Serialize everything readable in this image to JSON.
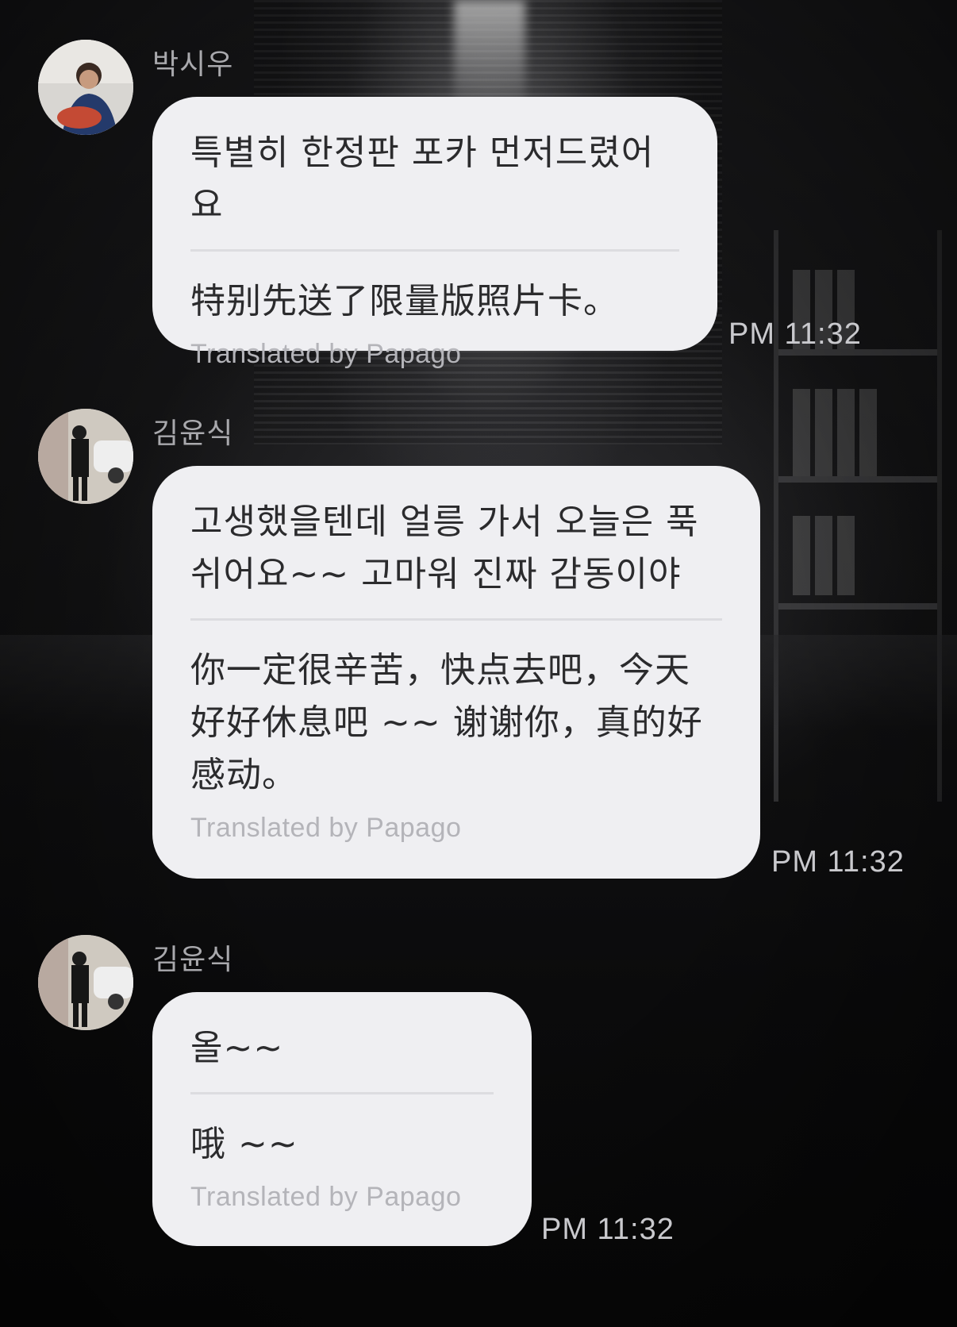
{
  "messages": [
    {
      "sender": "박시우",
      "original": "특별히 한정판 포카 먼저드렸어요",
      "translation": "特别先送了限量版照片卡。",
      "credit": "Translated by Papago",
      "time": "PM 11:32"
    },
    {
      "sender": "김윤식",
      "original": "고생했을텐데 얼릉 가서 오늘은 푹쉬어요~~ 고마워 진짜 감동이야",
      "translation": "你一定很辛苦，快点去吧，今天好好休息吧 ~~ 谢谢你，真的好感动。",
      "credit": "Translated by Papago",
      "time": "PM 11:32"
    },
    {
      "sender": "김윤식",
      "original": "올~~",
      "translation": "哦 ~~",
      "credit": "Translated by Papago",
      "time": "PM 11:32"
    }
  ]
}
